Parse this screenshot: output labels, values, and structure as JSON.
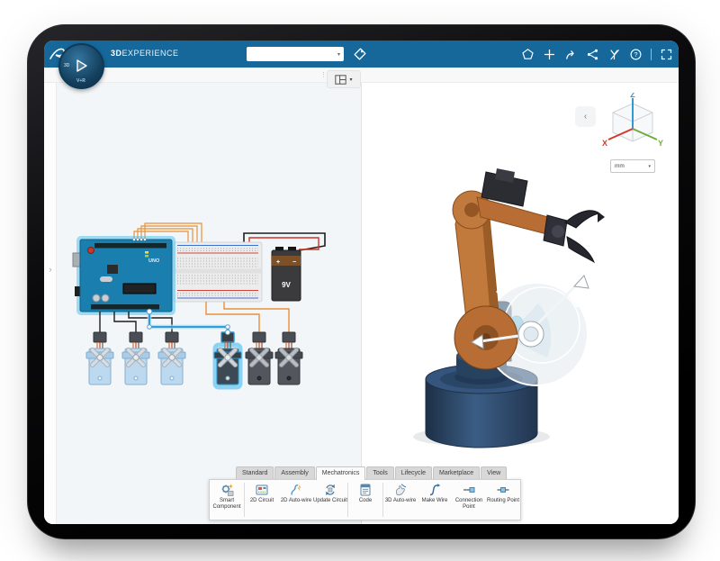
{
  "header": {
    "brand_bold": "3D",
    "brand_rest": "EXPERIENCE",
    "search_value": "",
    "search_placeholder": "",
    "compass_left": "3D",
    "compass_bottom": "V+R"
  },
  "icons": {
    "search_caret": "▾",
    "layout_caret": "▾",
    "units_caret": "▾",
    "help_glyph": "?",
    "drag_dots": "⋮",
    "expand_chevron": "›",
    "collapse_chevron": "‹"
  },
  "circuit": {
    "board_label": "UNO",
    "battery_label": "9V",
    "battery_plus": "+",
    "battery_minus": "−"
  },
  "viewcube": {
    "x_label": "X",
    "y_label": "Y",
    "z_label": "Z"
  },
  "units": {
    "value": "mm"
  },
  "ribbon": {
    "tabs": [
      {
        "label": "Standard"
      },
      {
        "label": "Assembly"
      },
      {
        "label": "Mechatronics"
      },
      {
        "label": "Tools"
      },
      {
        "label": "Lifecycle"
      },
      {
        "label": "Marketplace"
      },
      {
        "label": "View"
      }
    ],
    "active_tab": "Mechatronics",
    "tools": [
      {
        "label": "Smart Component"
      },
      {
        "label": "2D Circuit"
      },
      {
        "label": "2D Auto-wire"
      },
      {
        "label": "Update Circuit"
      },
      {
        "label": "Code"
      },
      {
        "label": "3D Auto-wire"
      },
      {
        "label": "Make Wire"
      },
      {
        "label": "Connection Point"
      },
      {
        "label": "Routing Point"
      }
    ]
  },
  "colors": {
    "topbar_blue": "#16689b",
    "selection_blue": "#2fa9e0",
    "robot_orange": "#bb7034",
    "robot_base_navy": "#2a4565",
    "axis_x_red": "#d23a2e",
    "axis_y_green": "#6fae3e",
    "axis_z_blue": "#2f9bd6",
    "wire_orange": "#e8913a",
    "wire_red": "#cc3327",
    "wire_blue": "#2e9fd9"
  }
}
